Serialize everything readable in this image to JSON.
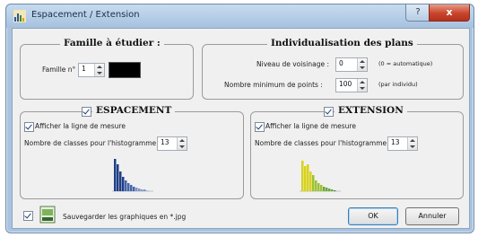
{
  "window": {
    "title": "Espacement / Extension",
    "help_button": "?",
    "close_button": "x"
  },
  "famille": {
    "title": "Famille à étudier :",
    "label": "Famille n°",
    "value": "1",
    "color": "#000000"
  },
  "individualisation": {
    "title": "Individualisation des plans",
    "voisinage_label": "Niveau de voisinage :",
    "voisinage_value": "0",
    "voisinage_note": "(0 = automatique)",
    "points_label": "Nombre minimum de points :",
    "points_value": "100",
    "points_note": "(par individu)"
  },
  "espacement": {
    "title": "ESPACEMENT",
    "afficher_label": "Afficher la ligne de mesure",
    "classes_label": "Nombre de classes pour l'histogramme :",
    "classes_value": "13",
    "histogram_colors": [
      "#1f3f86",
      "#4466a8",
      "#7b95c6",
      "#a9bde0"
    ]
  },
  "extension": {
    "title": "EXTENSION",
    "afficher_label": "Afficher la ligne de mesure",
    "classes_label": "Nombre de classes pour l'histogramme :",
    "classes_value": "13",
    "histogram_colors": [
      "#d8d21a",
      "#9cc232",
      "#68a93a",
      "#3f8a3c"
    ]
  },
  "footer": {
    "save_label": "Sauvegarder les graphiques en *.jpg",
    "ok_label": "OK",
    "cancel_label": "Annuler"
  }
}
